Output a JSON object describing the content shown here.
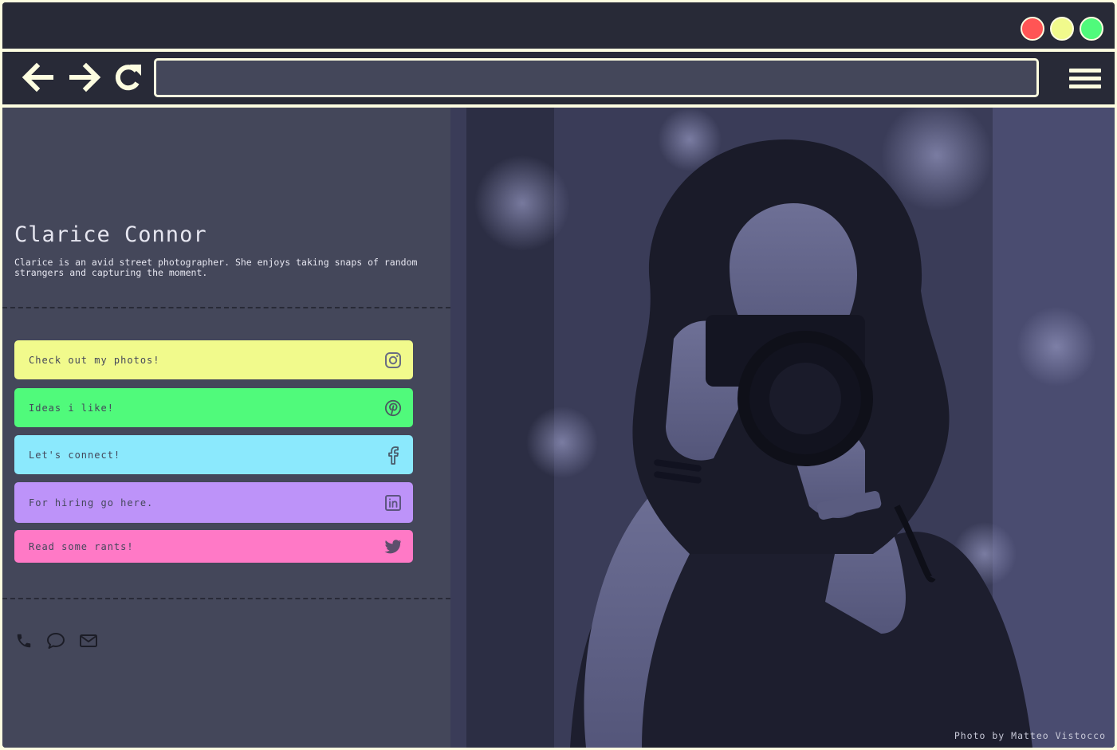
{
  "window": {
    "controls": {
      "close_color": "#ff5555",
      "minimize_color": "#f1fa8c",
      "maximize_color": "#50fa7b"
    }
  },
  "toolbar": {
    "back_icon": "arrow-left-icon",
    "forward_icon": "arrow-right-icon",
    "reload_icon": "reload-icon",
    "menu_icon": "hamburger-menu-icon",
    "address_value": "",
    "address_placeholder": ""
  },
  "profile": {
    "name": "Clarice Connor",
    "bio": "Clarice is an avid street photographer. She enjoys taking snaps of random strangers and capturing the moment."
  },
  "links": [
    {
      "label": "Check out my photos!",
      "icon": "instagram-icon",
      "color": "#f1fa8c"
    },
    {
      "label": "Ideas i like!",
      "icon": "pinterest-icon",
      "color": "#50fa7b"
    },
    {
      "label": "Let's connect!",
      "icon": "facebook-icon",
      "color": "#8be9fd"
    },
    {
      "label": "For hiring go here.",
      "icon": "linkedin-icon",
      "color": "#bd93f9"
    },
    {
      "label": "Read some rants!",
      "icon": "twitter-icon",
      "color": "#ff79c6"
    }
  ],
  "contact": {
    "icons": [
      "phone-icon",
      "chat-bubble-icon",
      "mail-icon"
    ]
  },
  "photo": {
    "credit": "Photo by Matteo Vistocco"
  },
  "colors": {
    "background_dark": "#282a37",
    "panel": "#44475a",
    "frame": "#fdfde0"
  }
}
